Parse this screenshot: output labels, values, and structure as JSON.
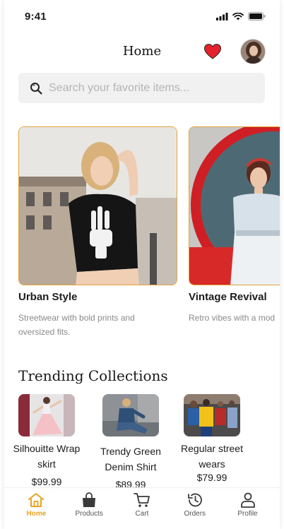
{
  "status": {
    "time": "9:41"
  },
  "header": {
    "title": "Home"
  },
  "search": {
    "placeholder": "Search your favorite items..."
  },
  "featured": [
    {
      "title": "Urban Style",
      "description": "Streetwear with bold prints and oversized fits."
    },
    {
      "title": "Vintage Revival",
      "description": "Retro vibes with a mod"
    }
  ],
  "trending": {
    "title": "Trending Collections",
    "items": [
      {
        "name": "Silhouitte Wrap  skirt",
        "price": "$99.99"
      },
      {
        "name": "Trendy Green Denim Shirt",
        "price": "$89.99"
      },
      {
        "name": "Regular street wears",
        "price": "$79.99"
      }
    ]
  },
  "nav": [
    {
      "label": "Home",
      "icon": "home-icon",
      "active": true
    },
    {
      "label": "Products",
      "icon": "bag-icon",
      "active": false
    },
    {
      "label": "Cart",
      "icon": "cart-icon",
      "active": false
    },
    {
      "label": "Orders",
      "icon": "history-icon",
      "active": false
    },
    {
      "label": "Profile",
      "icon": "user-icon",
      "active": false
    }
  ],
  "colors": {
    "accent": "#e8a321",
    "heart": "#e3222d",
    "card_border": "#e0a43a"
  }
}
